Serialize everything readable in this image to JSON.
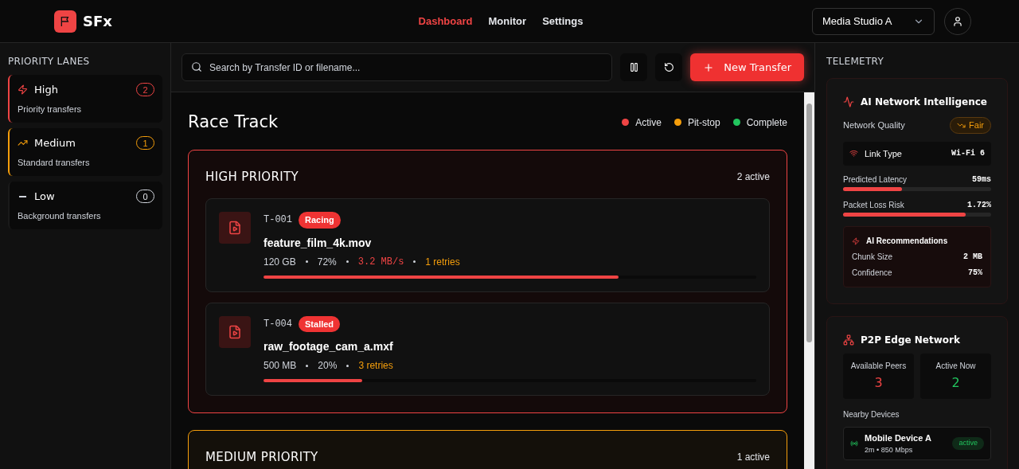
{
  "header": {
    "logo": "SFx",
    "nav": [
      {
        "label": "Dashboard",
        "selected": true
      },
      {
        "label": "Monitor",
        "selected": false
      },
      {
        "label": "Settings",
        "selected": false
      }
    ],
    "workspace": "Media Studio A"
  },
  "sidebar": {
    "title": "PRIORITY LANES",
    "lanes": [
      {
        "kind": "high",
        "label": "High",
        "subtitle": "Priority transfers",
        "count": "2"
      },
      {
        "kind": "medium",
        "label": "Medium",
        "subtitle": "Standard transfers",
        "count": "1"
      },
      {
        "kind": "low",
        "label": "Low",
        "subtitle": "Background transfers",
        "count": "0"
      }
    ]
  },
  "toolbar": {
    "search_placeholder": "Search by Transfer ID or filename...",
    "new_button": "New Transfer"
  },
  "race_track": {
    "title": "Race Track",
    "legend": [
      {
        "label": "Active",
        "color": "#ef4444"
      },
      {
        "label": "Pit-stop",
        "color": "#f59e0b"
      },
      {
        "label": "Complete",
        "color": "#22c55e"
      }
    ],
    "sections": [
      {
        "kind": "high",
        "title": "HIGH PRIORITY",
        "count": "2 active",
        "transfers": [
          {
            "id": "T-001",
            "status": "Racing",
            "filename": "feature_film_4k.mov",
            "size": "120 GB",
            "percent": "72%",
            "speed": "3.2 MB/s",
            "retries": "1 retries",
            "level": 0.72
          },
          {
            "id": "T-004",
            "status": "Stalled",
            "filename": "raw_footage_cam_a.mxf",
            "size": "500 MB",
            "percent": "20%",
            "retries": "3 retries",
            "level": 0.2
          }
        ]
      },
      {
        "kind": "medium",
        "title": "MEDIUM PRIORITY",
        "count": "1 active"
      }
    ]
  },
  "telemetry": {
    "title": "TELEMETRY",
    "ai": {
      "title": "AI Network Intelligence",
      "quality_label": "Network Quality",
      "quality": "Fair",
      "link_label": "Link Type",
      "link": "Wi-Fi 6",
      "metrics": [
        {
          "label": "Predicted Latency",
          "value": "59ms",
          "level": 0.4
        },
        {
          "label": "Packet Loss Risk",
          "value": "1.72%",
          "level": 0.83
        }
      ],
      "recommendations": {
        "title": "AI Recommendations",
        "rows": [
          {
            "label": "Chunk Size",
            "value": "2 MB"
          },
          {
            "label": "Confidence",
            "value": "75%"
          }
        ]
      }
    },
    "p2p": {
      "title": "P2P Edge Network",
      "stats": [
        {
          "label": "Available Peers",
          "value": "3",
          "color": "#ef4444"
        },
        {
          "label": "Active Now",
          "value": "2",
          "color": "#22c55e"
        }
      ],
      "devices_label": "Nearby Devices",
      "devices": [
        {
          "name": "Mobile Device A",
          "detail": "2m • 850 Mbps",
          "status": "active"
        }
      ]
    }
  }
}
